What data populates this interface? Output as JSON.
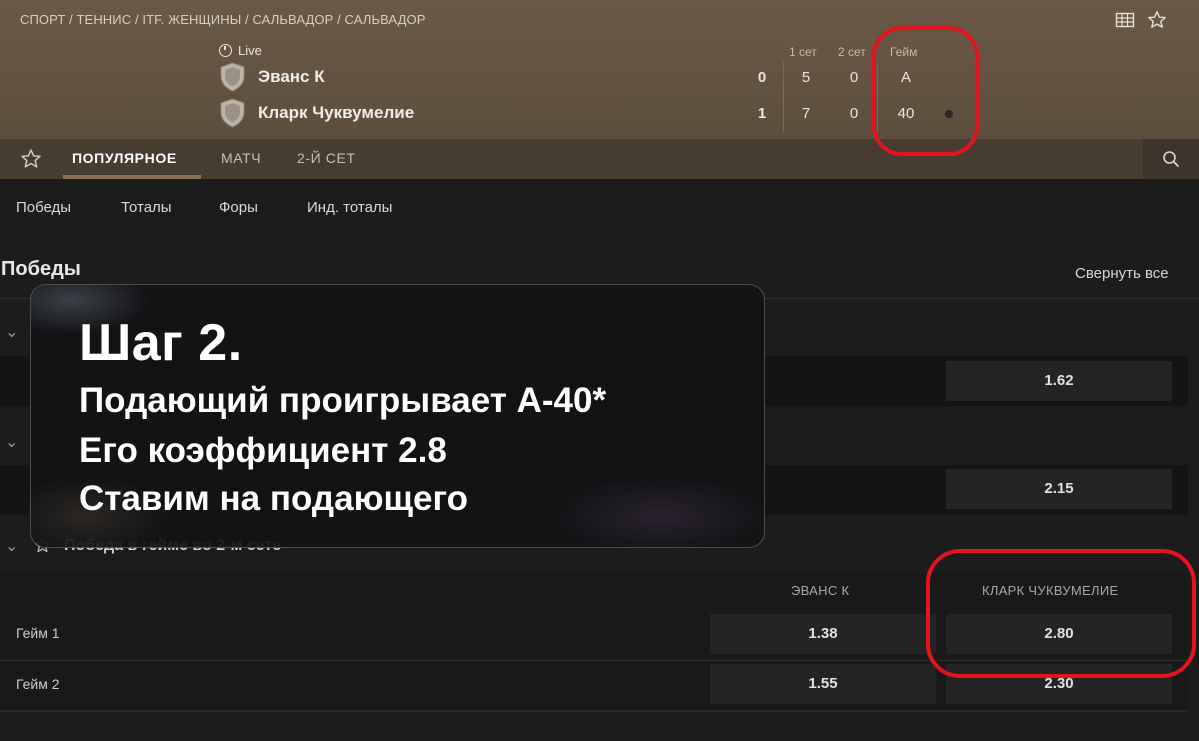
{
  "breadcrumb": "СПОРТ / ТЕННИС / ITF. ЖЕНЩИНЫ / САЛЬВАДОР / САЛЬВАДОР",
  "header_icons": {
    "left": "scoreboard-icon",
    "right": "star-icon"
  },
  "match": {
    "status": "Live",
    "columns": {
      "set1": "1 сет",
      "set2": "2 сет",
      "game": "Гейм"
    },
    "players": [
      {
        "name": "Эванс К",
        "sets": "0",
        "set1": "5",
        "set2": "0",
        "game": "A"
      },
      {
        "name": "Кларк Чуквумелие",
        "sets": "1",
        "set1": "7",
        "set2": "0",
        "game": "40"
      }
    ],
    "serving_player_index": 1
  },
  "tabs": [
    {
      "label": "ПОПУЛЯРНОЕ",
      "active": true
    },
    {
      "label": "МАТЧ",
      "active": false
    },
    {
      "label": "2-Й СЕТ",
      "active": false
    }
  ],
  "filters": [
    "Победы",
    "Тоталы",
    "Форы",
    "Инд. тоталы"
  ],
  "section": {
    "title": "Победы",
    "collapse_all": "Свернуть все"
  },
  "markets": {
    "row1_odds_right": "1.62",
    "row2_odds_right": "2.15",
    "game_market": {
      "title": "Победа в гейме во 2-м сете",
      "columns": [
        "ЭВАНС К",
        "КЛАРК ЧУКВУМЕЛИЕ"
      ],
      "rows": [
        {
          "label": "Гейм 1",
          "odds": [
            "1.38",
            "2.80"
          ]
        },
        {
          "label": "Гейм 2",
          "odds": [
            "1.55",
            "2.30"
          ]
        }
      ]
    }
  },
  "overlay": {
    "step": "Шаг 2.",
    "lines": [
      "Подающий проигрывает А-40*",
      "Его коэффициент 2.8",
      "Ставим на подающего"
    ]
  },
  "colors": {
    "highlight": "#e3141d",
    "header_bg": "#6a5945",
    "page_bg": "#1c1c1c"
  }
}
